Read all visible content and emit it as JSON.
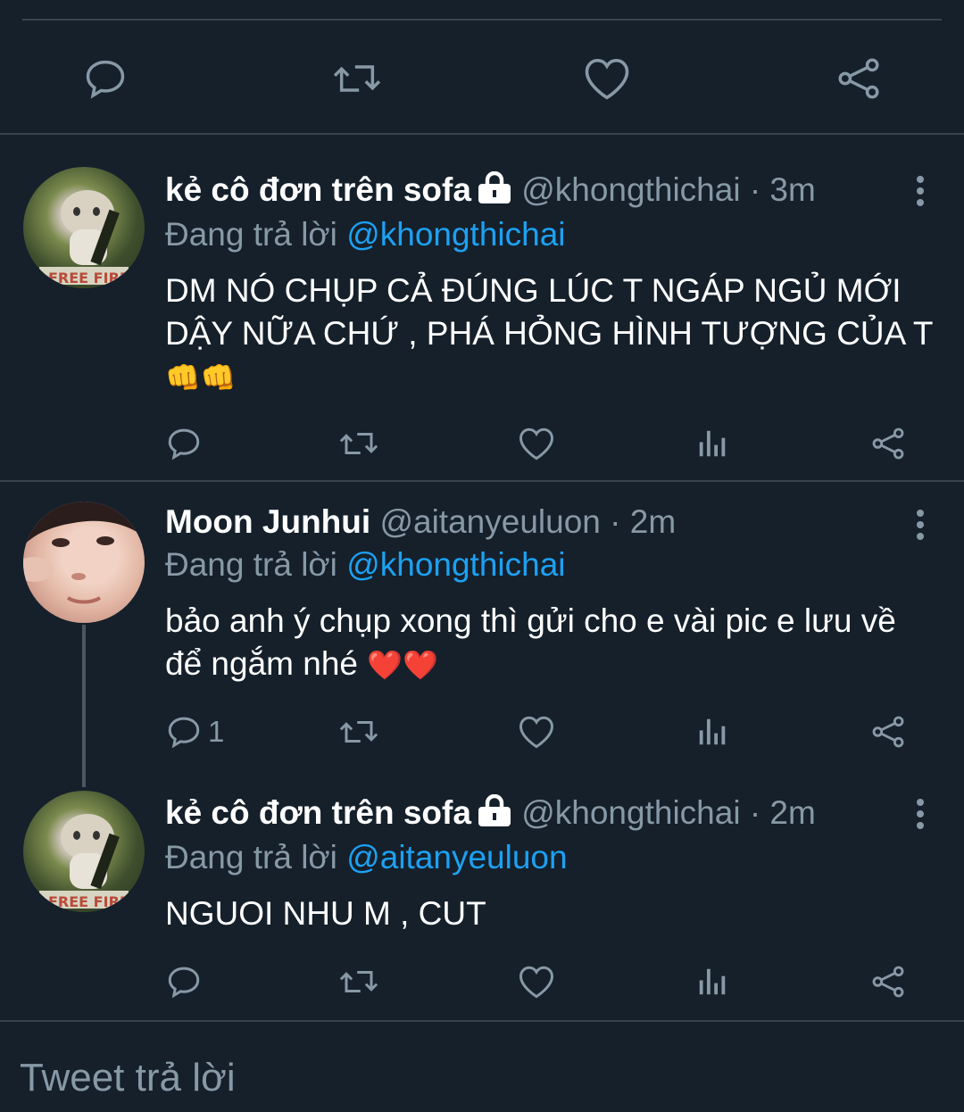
{
  "top_bar": {
    "icons": [
      "reply-icon",
      "retweet-icon",
      "like-icon",
      "share-icon"
    ]
  },
  "tweets": [
    {
      "name": "kẻ cô đơn trên sofa",
      "handle": "@khongthichai · 3m",
      "replying_prefix": "Đang trả lời ",
      "replying_to": "@khongthichai",
      "text": "DM NÓ CHỤP CẢ ĐÚNG LÚC T NGÁP NGỦ MỚI DẬY NỮA CHỨ , PHÁ HỎNG HÌNH TƯỢNG CỦA T",
      "emoji": "👊👊",
      "reply_count": ""
    },
    {
      "name": "Moon Junhui",
      "handle": "@aitanyeuluon · 2m",
      "replying_prefix": "Đang trả lời ",
      "replying_to": "@khongthichai",
      "text": "bảo anh ý chụp xong thì gửi cho e vài pic e lưu về để ngắm nhé",
      "emoji": "❤️❤️",
      "reply_count": "1"
    },
    {
      "name": "kẻ cô đơn trên sofa",
      "handle": "@khongthichai · 2m",
      "replying_prefix": "Đang trả lời ",
      "replying_to": "@aitanyeuluon",
      "text": "NGUOI NHU M , CUT",
      "emoji": "",
      "reply_count": ""
    }
  ],
  "compose": {
    "placeholder": "Tweet trả lời"
  },
  "colors": {
    "background": "#15202b",
    "divider": "#38444d",
    "secondary_text": "#8899a6",
    "accent": "#1da1f2"
  }
}
